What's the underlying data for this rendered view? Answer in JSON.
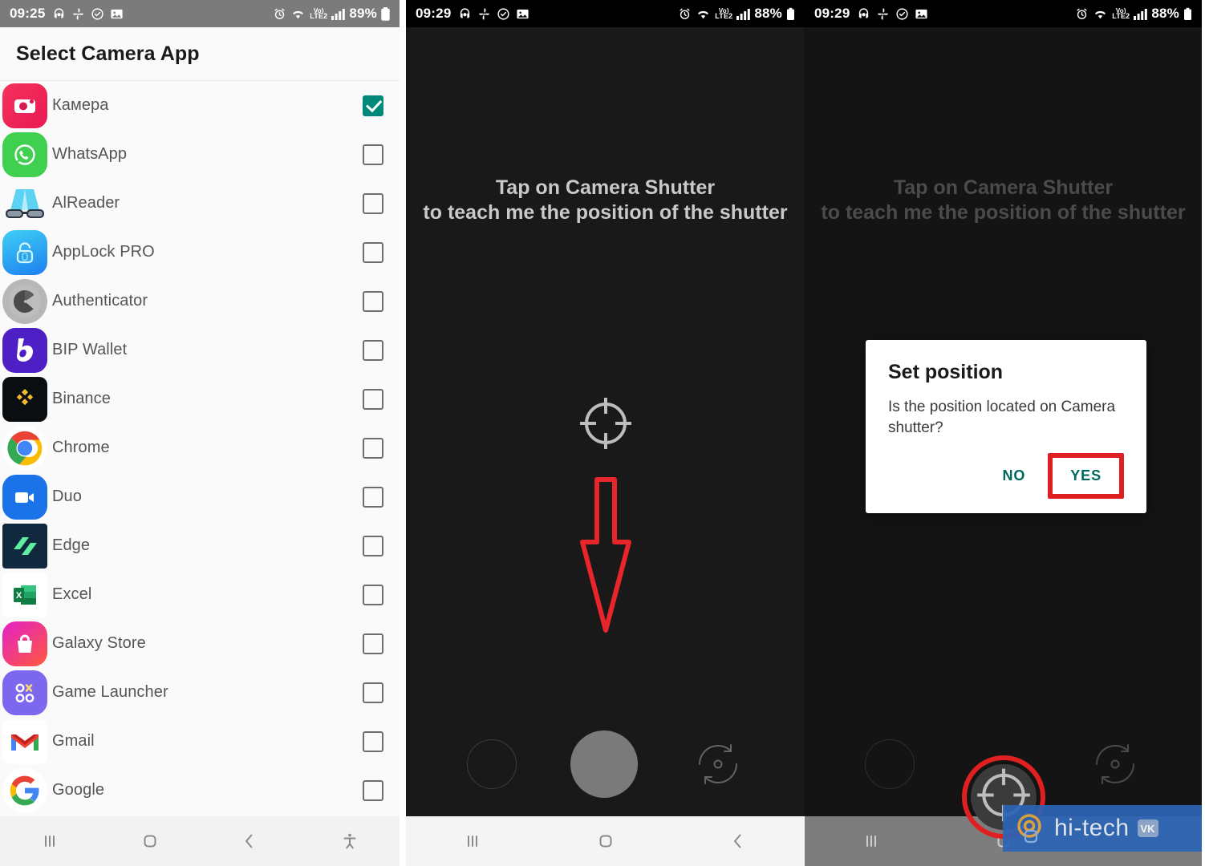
{
  "panel1": {
    "statusbar": {
      "time": "09:25",
      "battery": "89%",
      "network": "LTE2",
      "voice": "Vo)",
      "icons": [
        "headset-icon",
        "fan-icon",
        "shield-check-icon",
        "gallery-icon",
        "alarm-icon",
        "wifi-icon",
        "signal-icon",
        "battery-icon"
      ]
    },
    "title": "Select Camera App",
    "apps": [
      {
        "name": "Камера",
        "checked": true,
        "icon": "camera-app-icon"
      },
      {
        "name": "WhatsApp",
        "checked": false,
        "icon": "whatsapp-icon"
      },
      {
        "name": "AlReader",
        "checked": false,
        "icon": "alreader-icon"
      },
      {
        "name": "AppLock PRO",
        "checked": false,
        "icon": "applock-icon"
      },
      {
        "name": "Authenticator",
        "checked": false,
        "icon": "authenticator-icon"
      },
      {
        "name": "BIP Wallet",
        "checked": false,
        "icon": "bip-wallet-icon"
      },
      {
        "name": "Binance",
        "checked": false,
        "icon": "binance-icon"
      },
      {
        "name": "Chrome",
        "checked": false,
        "icon": "chrome-icon"
      },
      {
        "name": "Duo",
        "checked": false,
        "icon": "duo-icon"
      },
      {
        "name": "Edge",
        "checked": false,
        "icon": "edge-icon"
      },
      {
        "name": "Excel",
        "checked": false,
        "icon": "excel-icon"
      },
      {
        "name": "Galaxy Store",
        "checked": false,
        "icon": "galaxy-store-icon"
      },
      {
        "name": "Game Launcher",
        "checked": false,
        "icon": "game-launcher-icon"
      },
      {
        "name": "Gmail",
        "checked": false,
        "icon": "gmail-icon"
      },
      {
        "name": "Google",
        "checked": false,
        "icon": "google-icon"
      }
    ],
    "navbar": [
      "recents-icon",
      "home-icon",
      "back-icon",
      "accessibility-icon"
    ]
  },
  "panel2": {
    "statusbar": {
      "time": "09:29",
      "battery": "88%",
      "network": "LTE2",
      "voice": "Vo)"
    },
    "instruction_line1": "Tap on Camera Shutter",
    "instruction_line2": "to teach me the position of the shutter",
    "crosshair": "crosshair-target-icon",
    "arrow": "red-down-arrow-icon",
    "controls": [
      "gallery-thumbnail-button",
      "camera-shutter-button",
      "flip-camera-button"
    ],
    "navbar": [
      "recents-icon",
      "home-icon",
      "back-icon"
    ]
  },
  "panel3": {
    "statusbar": {
      "time": "09:29",
      "battery": "88%",
      "network": "LTE2",
      "voice": "Vo)"
    },
    "instruction_line1": "Tap on Camera Shutter",
    "instruction_line2": "to teach me the position of the shutter",
    "dialog": {
      "title": "Set position",
      "message": "Is the position located on Camera shutter?",
      "no_label": "NO",
      "yes_label": "YES",
      "highlight_color": "#e02020",
      "action_color": "#00695c"
    },
    "highlighted_shutter": "camera-shutter-target-highlight",
    "navbar": [
      "recents-icon",
      "home-icon",
      "back-icon"
    ],
    "watermark": {
      "text": "hi-tech",
      "badge": "VK",
      "bg": "#2c63b4"
    }
  }
}
